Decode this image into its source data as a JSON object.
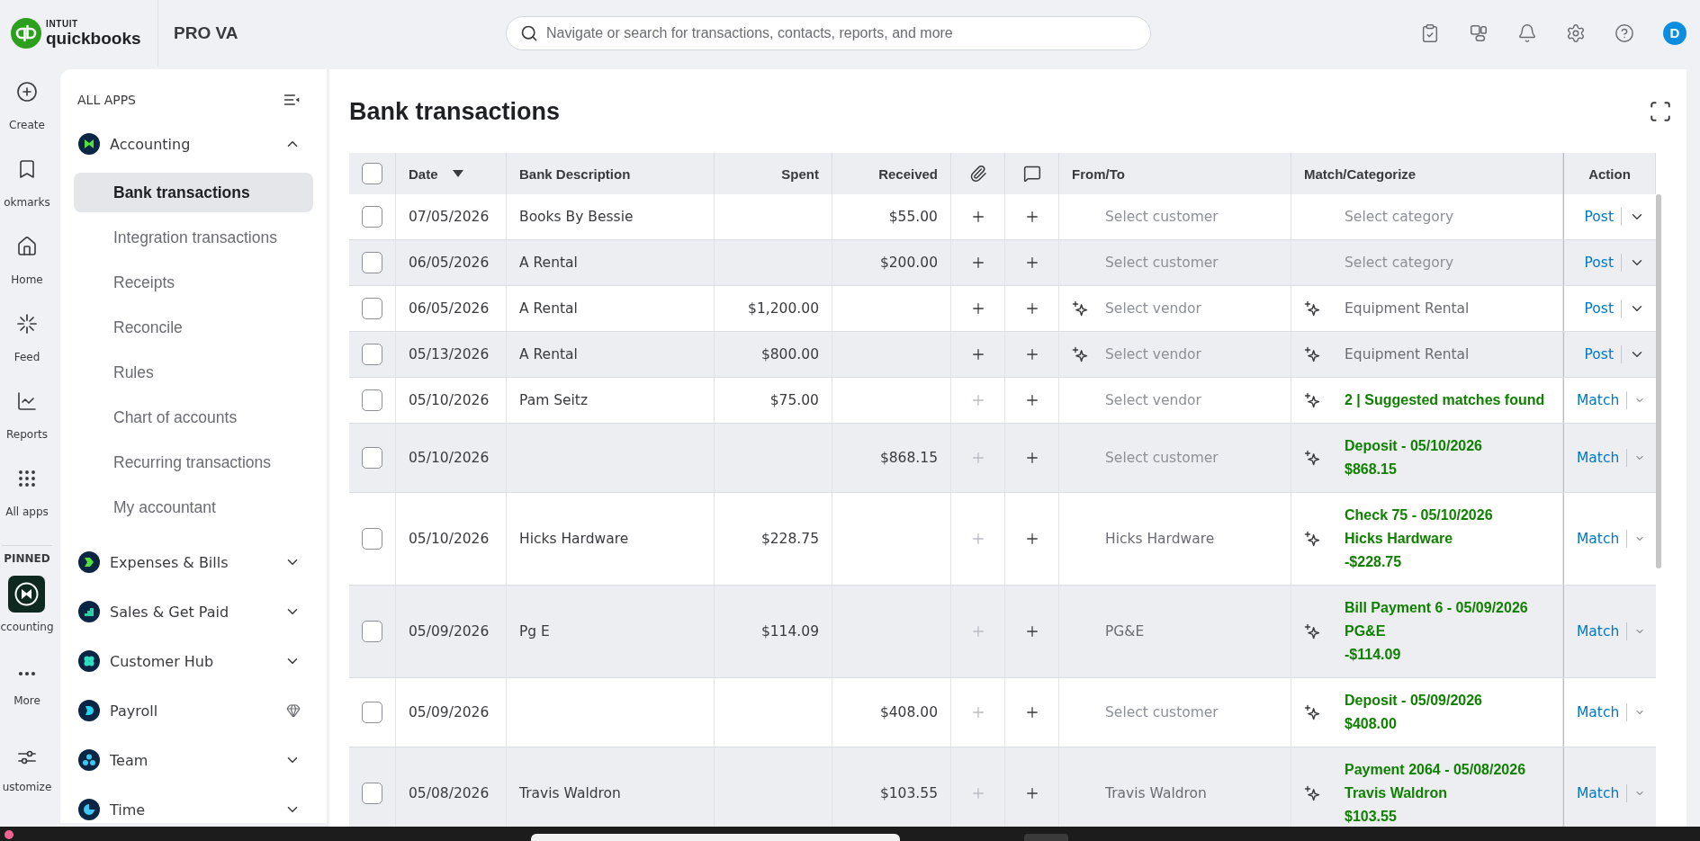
{
  "top_bar": {
    "brand": {
      "maker": "INTUIT",
      "product": "quickbooks"
    },
    "company": "PRO VA",
    "search": {
      "placeholder": "Navigate or search for transactions, contacts, reports, and more"
    },
    "avatar": {
      "initial": "D"
    }
  },
  "rail": {
    "items": [
      {
        "label": "Create"
      },
      {
        "label": "okmarks"
      },
      {
        "label": "Home"
      },
      {
        "label": "Feed"
      },
      {
        "label": "Reports"
      },
      {
        "label": "All apps"
      }
    ],
    "section_label": "PINNED",
    "pinned": [
      {
        "label": "ccounting"
      }
    ],
    "bottom_items": [
      {
        "label": "More"
      },
      {
        "label": "ustomize"
      }
    ]
  },
  "sidebar": {
    "heading": "ALL APPS",
    "apps": [
      {
        "label": "Accounting",
        "kind": "expandable",
        "expanded": true,
        "children": [
          {
            "label": "Bank transactions",
            "selected": true
          },
          {
            "label": "Integration transactions",
            "selected": false
          },
          {
            "label": "Receipts",
            "selected": false
          },
          {
            "label": "Reconcile",
            "selected": false
          },
          {
            "label": "Rules",
            "selected": false
          },
          {
            "label": "Chart of accounts",
            "selected": false
          },
          {
            "label": "Recurring transactions",
            "selected": false
          },
          {
            "label": "My accountant",
            "selected": false
          }
        ]
      },
      {
        "label": "Expenses & Bills",
        "kind": "expandable",
        "expanded": false
      },
      {
        "label": "Sales & Get Paid",
        "kind": "expandable",
        "expanded": false
      },
      {
        "label": "Customer Hub",
        "kind": "expandable",
        "expanded": false
      },
      {
        "label": "Payroll",
        "kind": "premium"
      },
      {
        "label": "Team",
        "kind": "expandable",
        "expanded": false
      },
      {
        "label": "Time",
        "kind": "expandable",
        "expanded": false
      }
    ]
  },
  "page": {
    "title": "Bank transactions"
  },
  "table": {
    "select_all": {
      "checked": false
    },
    "columns": [
      {
        "label": "Date",
        "sorted": true
      },
      {
        "label": "Bank Description",
        "sorted": false
      },
      {
        "label": "Spent",
        "sorted": false
      },
      {
        "label": "Received",
        "sorted": false
      },
      {
        "label": "From/To",
        "sorted": false
      },
      {
        "label": "Match/Categorize",
        "sorted": false
      },
      {
        "label": "Action",
        "sorted": false
      }
    ],
    "rows": [
      {
        "checked": false,
        "date": "07/05/2026",
        "description": "Books By Bessie",
        "received": "$55.00",
        "attach_disabled": false,
        "from_to": {
          "placeholder": "Select customer",
          "suggested": false
        },
        "match": {
          "kind": "category",
          "placeholder": "Select category",
          "suggested": false
        },
        "action": "Post"
      },
      {
        "checked": false,
        "date": "06/05/2026",
        "description": "A Rental",
        "received": "$200.00",
        "attach_disabled": false,
        "from_to": {
          "placeholder": "Select customer",
          "suggested": false
        },
        "match": {
          "kind": "category",
          "placeholder": "Select category",
          "suggested": false
        },
        "action": "Post"
      },
      {
        "checked": false,
        "date": "06/05/2026",
        "description": "A Rental",
        "spent": "$1,200.00",
        "attach_disabled": false,
        "from_to": {
          "placeholder": "Select vendor",
          "suggested": true
        },
        "match": {
          "kind": "category",
          "value": "Equipment Rental",
          "suggested": true
        },
        "action": "Post"
      },
      {
        "checked": false,
        "date": "05/13/2026",
        "description": "A Rental",
        "spent": "$800.00",
        "attach_disabled": false,
        "from_to": {
          "placeholder": "Select vendor",
          "suggested": true
        },
        "match": {
          "kind": "category",
          "value": "Equipment Rental",
          "suggested": true
        },
        "action": "Post"
      },
      {
        "checked": false,
        "date": "05/10/2026",
        "description": "Pam Seitz",
        "spent": "$75.00",
        "attach_disabled": true,
        "from_to": {
          "placeholder": "Select vendor",
          "suggested": false
        },
        "match": {
          "kind": "match",
          "lines": [
            "2 | Suggested matches found"
          ],
          "suggested": true
        },
        "action": "Match"
      },
      {
        "checked": false,
        "date": "05/10/2026",
        "received": "$868.15",
        "attach_disabled": true,
        "from_to": {
          "placeholder": "Select customer",
          "suggested": false
        },
        "match": {
          "kind": "match",
          "lines": [
            "Deposit - 05/10/2026",
            "$868.15"
          ],
          "suggested": true
        },
        "action": "Match"
      },
      {
        "checked": false,
        "date": "05/10/2026",
        "description": "Hicks Hardware",
        "spent": "$228.75",
        "attach_disabled": true,
        "from_to": {
          "value": "Hicks Hardware",
          "suggested": false
        },
        "match": {
          "kind": "match",
          "lines": [
            "Check 75 - 05/10/2026",
            "Hicks Hardware",
            "-$228.75"
          ],
          "suggested": true
        },
        "action": "Match"
      },
      {
        "checked": false,
        "date": "05/09/2026",
        "description": "Pg E",
        "spent": "$114.09",
        "attach_disabled": true,
        "from_to": {
          "value": "PG&E",
          "suggested": false
        },
        "match": {
          "kind": "match",
          "lines": [
            "Bill Payment 6 - 05/09/2026",
            "PG&E",
            "-$114.09"
          ],
          "suggested": true
        },
        "action": "Match"
      },
      {
        "checked": false,
        "date": "05/09/2026",
        "received": "$408.00",
        "attach_disabled": true,
        "from_to": {
          "placeholder": "Select customer",
          "suggested": false
        },
        "match": {
          "kind": "match",
          "lines": [
            "Deposit - 05/09/2026",
            "$408.00"
          ],
          "suggested": true
        },
        "action": "Match"
      },
      {
        "checked": false,
        "date": "05/08/2026",
        "description": "Travis Waldron",
        "received": "$103.55",
        "attach_disabled": true,
        "from_to": {
          "value": "Travis Waldron",
          "suggested": false
        },
        "match": {
          "kind": "match",
          "lines": [
            "Payment 2064 - 05/08/2026",
            "Travis Waldron",
            "$103.55"
          ],
          "suggested": true
        },
        "action": "Match"
      }
    ]
  }
}
